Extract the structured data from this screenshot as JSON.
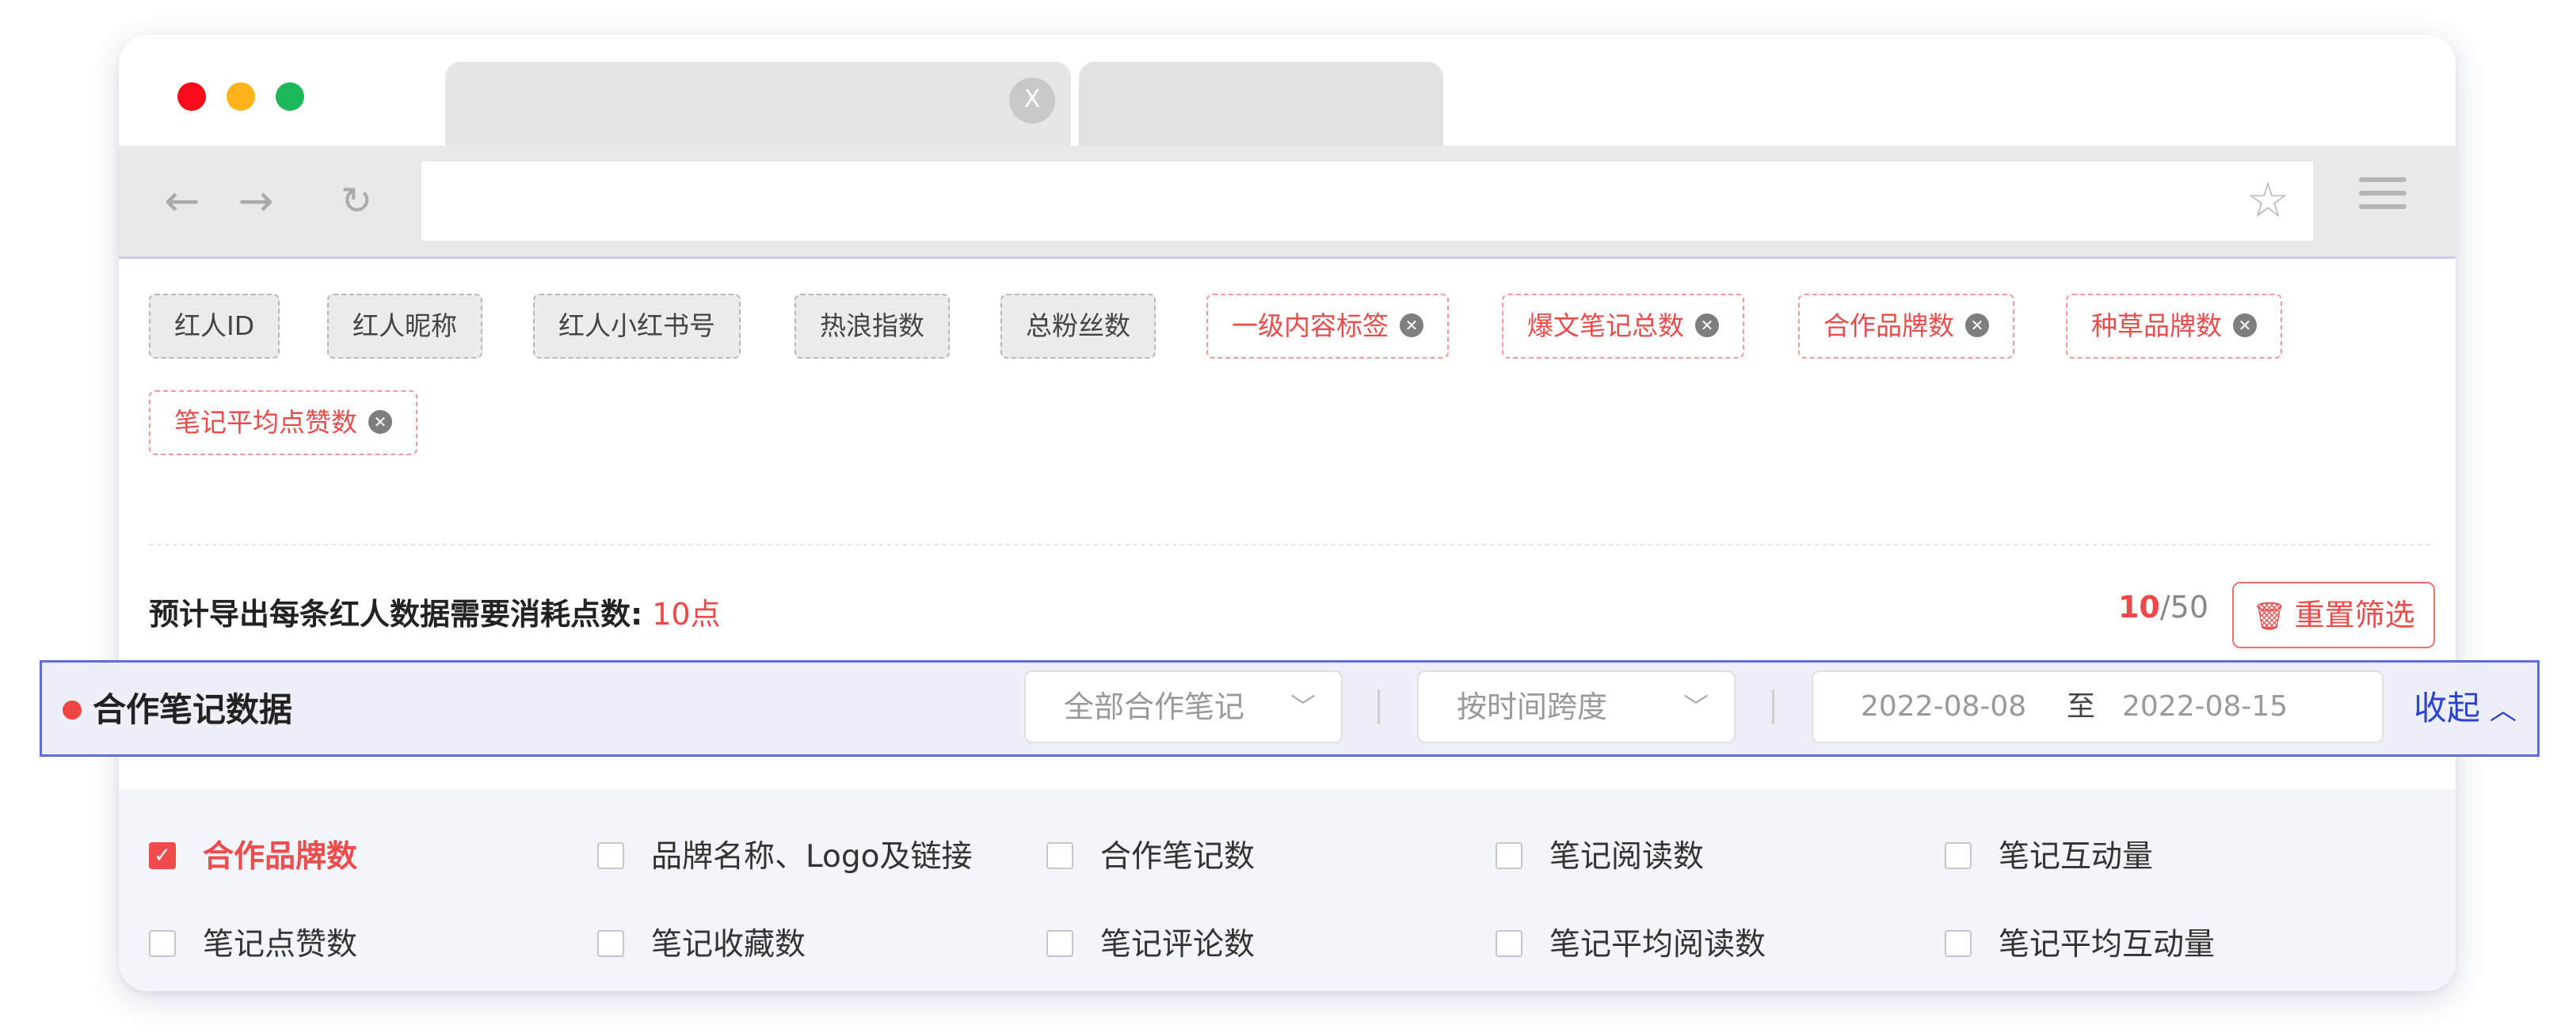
{
  "window": {
    "tab_close_label": "X"
  },
  "fields": {
    "fixed": [
      "红人ID",
      "红人昵称",
      "红人小红书号",
      "热浪指数",
      "总粉丝数"
    ],
    "removable": [
      "一级内容标签",
      "爆文笔记总数",
      "合作品牌数",
      "种草品牌数",
      "笔记平均点赞数"
    ]
  },
  "summary": {
    "cost_label": "预计导出每条红人数据需要消耗点数:",
    "cost_value": "10点",
    "count_current": "10",
    "count_total": "/50",
    "reset_label": "重置筛选"
  },
  "section": {
    "title": "合作笔记数据",
    "note_filter": "全部合作笔记",
    "time_filter": "按时间跨度",
    "date_start": "2022-08-08",
    "date_sep": "至",
    "date_end": "2022-08-15",
    "collapse_label": "收起"
  },
  "checkboxes": [
    {
      "label": "合作品牌数",
      "checked": true
    },
    {
      "label": "品牌名称、Logo及链接",
      "checked": false
    },
    {
      "label": "合作笔记数",
      "checked": false
    },
    {
      "label": "笔记阅读数",
      "checked": false
    },
    {
      "label": "笔记互动量",
      "checked": false
    },
    {
      "label": "笔记点赞数",
      "checked": false
    },
    {
      "label": "笔记收藏数",
      "checked": false
    },
    {
      "label": "笔记评论数",
      "checked": false
    },
    {
      "label": "笔记平均阅读数",
      "checked": false
    },
    {
      "label": "笔记平均互动量",
      "checked": false
    }
  ],
  "colors": {
    "accent_red": "#ef4b4b",
    "accent_blue": "#5d6de0"
  }
}
